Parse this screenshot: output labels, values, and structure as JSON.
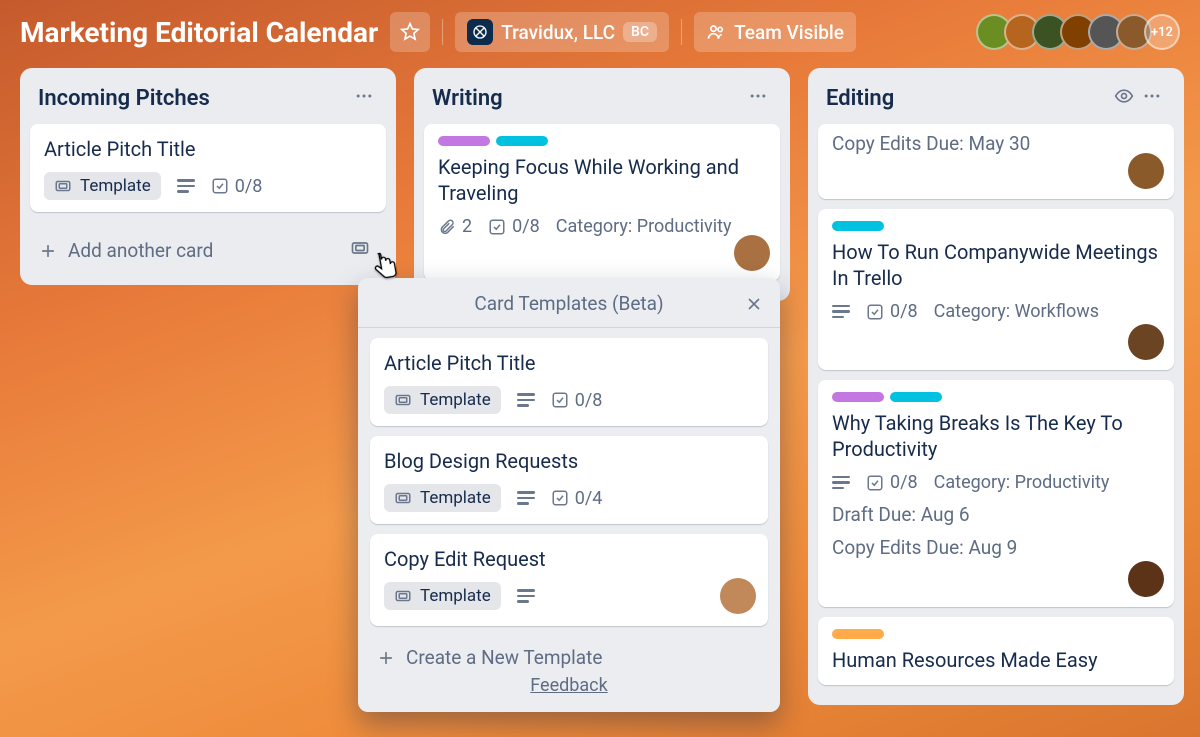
{
  "header": {
    "board_title": "Marketing Editorial Calendar",
    "workspace": "Travidux, LLC",
    "workspace_badge": "BC",
    "visibility": "Team Visible",
    "more_members": "+12"
  },
  "lists": {
    "incoming": {
      "title": "Incoming Pitches",
      "card0": {
        "title": "Article Pitch Title",
        "template_label": "Template",
        "checklist": "0/8"
      },
      "add_label": "Add another card"
    },
    "writing": {
      "title": "Writing",
      "card0": {
        "title": "Keeping Focus While Working and Traveling",
        "attachments": "2",
        "checklist": "0/8",
        "category": "Category: Productivity"
      }
    },
    "editing": {
      "title": "Editing",
      "card0": {
        "due": "Copy Edits Due: May 30"
      },
      "card1": {
        "title": "How To Run Companywide Meetings In Trello",
        "checklist": "0/8",
        "category": "Category: Workflows"
      },
      "card2": {
        "title": "Why Taking Breaks Is The Key To Productivity",
        "checklist": "0/8",
        "category": "Category: Productivity",
        "draft_due": "Draft Due: Aug 6",
        "copy_due": "Copy Edits Due: Aug 9"
      },
      "card3": {
        "title": "Human Resources Made Easy"
      }
    }
  },
  "popover": {
    "title": "Card Templates (Beta)",
    "items": {
      "0": {
        "title": "Article Pitch Title",
        "template_label": "Template",
        "checklist": "0/8"
      },
      "1": {
        "title": "Blog Design Requests",
        "template_label": "Template",
        "checklist": "0/4"
      },
      "2": {
        "title": "Copy Edit Request",
        "template_label": "Template"
      }
    },
    "create_label": "Create a New Template",
    "feedback_label": "Feedback"
  }
}
